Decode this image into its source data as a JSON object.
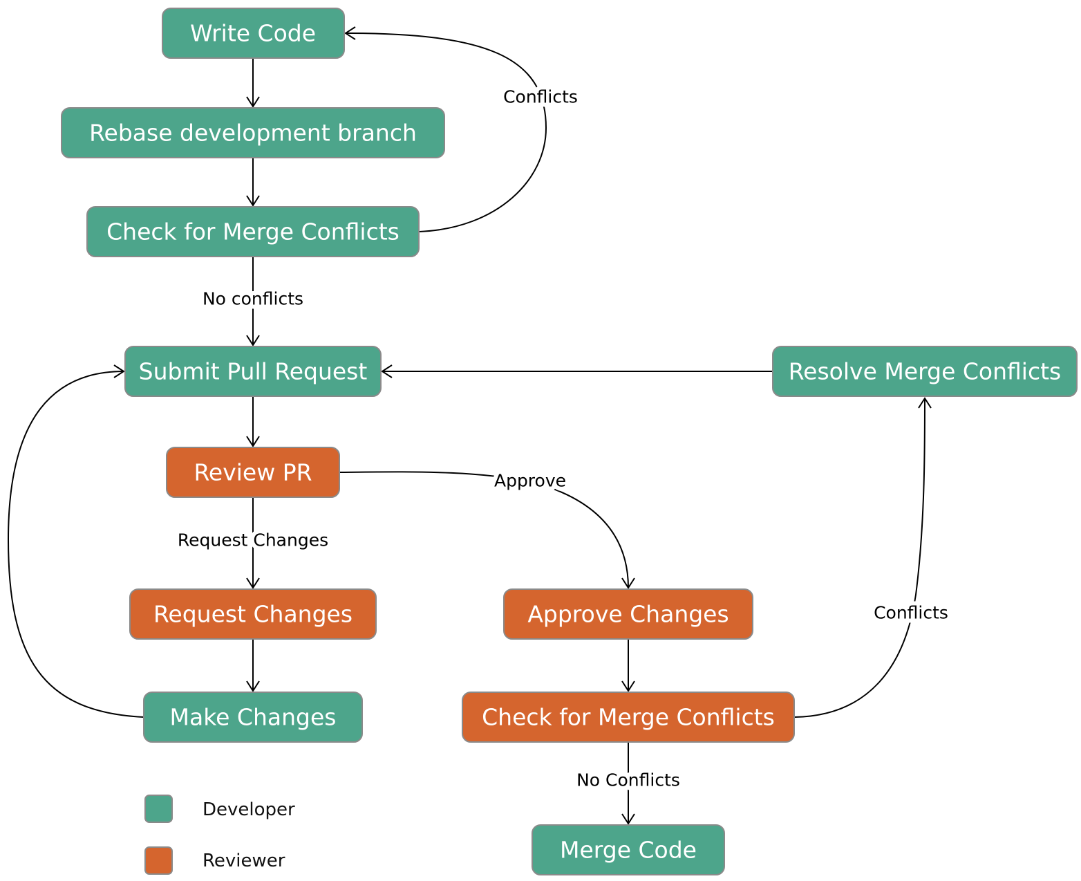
{
  "colors": {
    "developer": "#4DA58B",
    "reviewer": "#D5652E",
    "border": "#8A8A8A"
  },
  "nodes": {
    "write_code": "Write Code",
    "rebase": "Rebase development branch",
    "check_conflicts_dev": "Check for Merge Conflicts",
    "submit_pr": "Submit Pull Request",
    "resolve_conflicts": "Resolve Merge Conflicts",
    "review_pr": "Review PR",
    "request_changes": "Request Changes",
    "approve_changes": "Approve Changes",
    "make_changes": "Make Changes",
    "check_conflicts_rev": "Check for Merge Conflicts",
    "merge_code": "Merge Code"
  },
  "edge_labels": {
    "conflicts_top": "Conflicts",
    "no_conflicts_top": "No conflicts",
    "request_changes": "Request Changes",
    "approve": "Approve",
    "no_conflicts_bottom": "No Conflicts",
    "conflicts_right": "Conflicts"
  },
  "legend": [
    {
      "label": "Developer",
      "role": "developer"
    },
    {
      "label": "Reviewer",
      "role": "reviewer"
    }
  ]
}
